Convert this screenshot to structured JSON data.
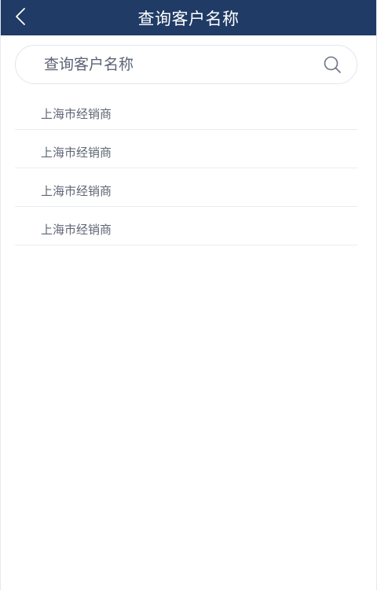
{
  "header": {
    "title": "查询客户名称",
    "back_icon": "chevron-left-icon"
  },
  "search": {
    "placeholder": "查询客户名称",
    "value": "",
    "icon": "search-icon"
  },
  "results": [
    {
      "label": "上海市经销商"
    },
    {
      "label": "上海市经销商"
    },
    {
      "label": "上海市经销商"
    },
    {
      "label": "上海市经销商"
    }
  ],
  "colors": {
    "header_bg": "#1f3b66",
    "header_text": "#ffffff",
    "item_text": "#5f6675",
    "divider": "#e9ecf1"
  }
}
